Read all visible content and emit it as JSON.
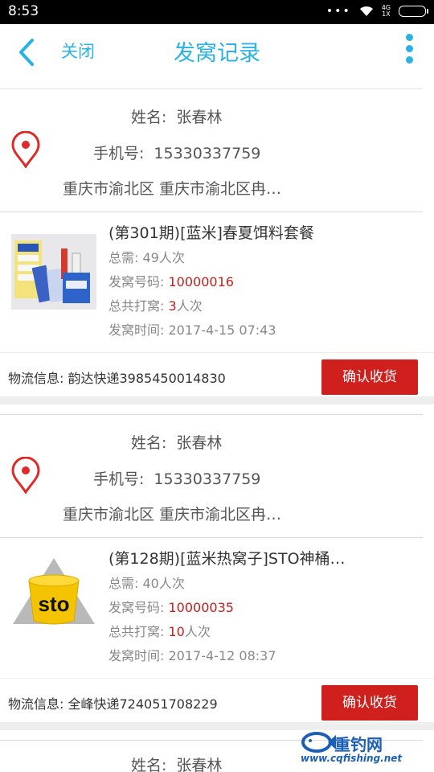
{
  "status_bar": {
    "time": "8:53",
    "network": "4G",
    "signal_label": "1X"
  },
  "nav": {
    "close_label": "关闭",
    "title": "发窝记录"
  },
  "records": [
    {
      "name_label": "姓名:",
      "name": "张春林",
      "phone_label": "手机号:",
      "phone": "15330337759",
      "address": "重庆市渝北区 重庆市渝北区冉…",
      "product_title": "(第301期)[蓝米]春夏饵料套餐",
      "total_label": "总需:",
      "total_value": "49人次",
      "code_label": "发窝号码:",
      "code_value": "10000016",
      "count_label": "总共打窝:",
      "count_value": "3",
      "count_unit": "人次",
      "time_label": "发窝时间:",
      "time_value": "2017-4-15 07:43",
      "logistics_label": "物流信息:",
      "logistics_value": "韵达快递3985450014830",
      "confirm_label": "确认收货"
    },
    {
      "name_label": "姓名:",
      "name": "张春林",
      "phone_label": "手机号:",
      "phone": "15330337759",
      "address": "重庆市渝北区 重庆市渝北区冉…",
      "product_title": "(第128期)[蓝米热窝子]STO神桶…",
      "product_logo_text": "sto",
      "total_label": "总需:",
      "total_value": "40人次",
      "code_label": "发窝号码:",
      "code_value": "10000035",
      "count_label": "总共打窝:",
      "count_value": "10",
      "count_unit": "人次",
      "time_label": "发窝时间:",
      "time_value": "2017-4-12 08:37",
      "logistics_label": "物流信息:",
      "logistics_value": "全峰快递724051708229",
      "confirm_label": "确认收货"
    },
    {
      "name_label": "姓名:",
      "name": "张春林"
    }
  ],
  "watermark": {
    "brand": "重钓网",
    "url": "www.cqfishing.net"
  },
  "colors": {
    "accent": "#2ab2e6",
    "button_red": "#d0201e",
    "value_red": "#c0201c"
  }
}
